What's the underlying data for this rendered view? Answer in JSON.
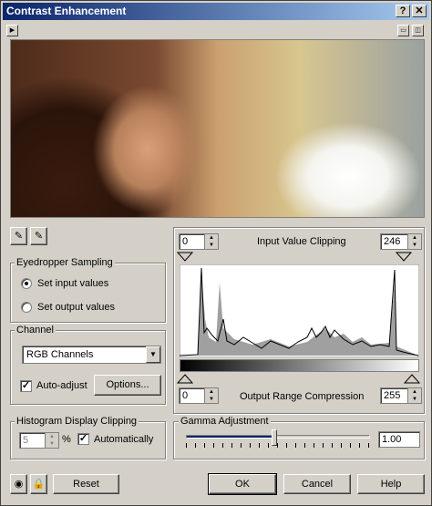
{
  "window": {
    "title": "Contrast Enhancement",
    "help_btn": "?",
    "close_btn": "✕"
  },
  "eyedropper": {
    "title": "Eyedropper Sampling",
    "opt1": "Set input values",
    "opt2": "Set output values",
    "selected": "opt1"
  },
  "channel": {
    "title": "Channel",
    "value": "RGB Channels",
    "auto_adjust": "Auto-adjust",
    "options_btn": "Options..."
  },
  "hist_clip": {
    "title": "Histogram Display Clipping",
    "value": "5",
    "unit": "%",
    "auto": "Automatically"
  },
  "input_clip": {
    "low": "0",
    "label": "Input Value Clipping",
    "high": "246"
  },
  "output_range": {
    "low": "0",
    "label": "Output Range Compression",
    "high": "255"
  },
  "gamma": {
    "title": "Gamma Adjustment",
    "value": "1.00",
    "slider_fraction": 0.48
  },
  "buttons": {
    "reset": "Reset",
    "ok": "OK",
    "cancel": "Cancel",
    "help": "Help"
  },
  "colors": {
    "titlebar_start": "#0a246a",
    "titlebar_end": "#a6caf0",
    "face": "#d4d0c8"
  }
}
